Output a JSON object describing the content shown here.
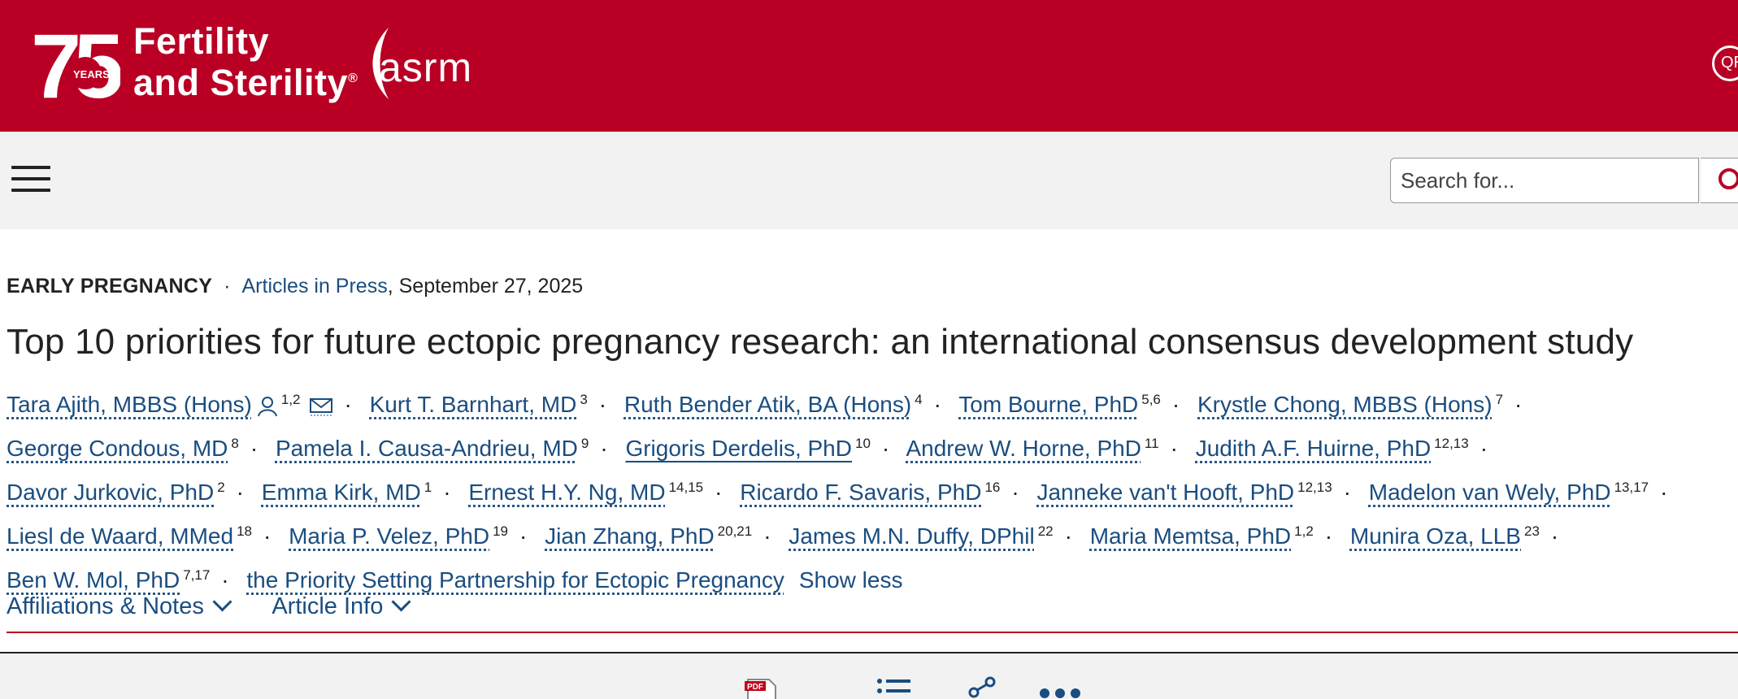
{
  "header": {
    "logo_number": "75",
    "logo_years": "YEARS",
    "journal_line1": "Fertility",
    "journal_line2": "and Sterility",
    "trademark": "®",
    "partner": "asrm",
    "qr_label": "QR",
    "brand_color": "#b90024"
  },
  "nav": {
    "menu_icon": "hamburger-menu-icon",
    "search_placeholder": "Search for...",
    "search_icon": "search-icon"
  },
  "article": {
    "section": "EARLY PREGNANCY",
    "status": "Articles in Press",
    "date": ", September 27, 2025",
    "title": "Top 10 priorities for future ectopic pregnancy research: an international consensus development study",
    "authors": [
      {
        "name": "Tara Ajith, MBBS (Hons)",
        "sup": "1,2"
      },
      {
        "name": "Kurt T. Barnhart, MD",
        "sup": "3"
      },
      {
        "name": "Ruth Bender Atik, BA (Hons)",
        "sup": "4"
      },
      {
        "name": "Tom Bourne, PhD",
        "sup": "5,6"
      },
      {
        "name": "Krystle Chong, MBBS (Hons)",
        "sup": "7"
      },
      {
        "name": "George Condous, MD",
        "sup": "8"
      },
      {
        "name": "Pamela I. Causa-Andrieu, MD",
        "sup": "9"
      },
      {
        "name": "Grigoris Derdelis, PhD",
        "sup": "10"
      },
      {
        "name": "Andrew W. Horne, PhD",
        "sup": "11"
      },
      {
        "name": "Judith A.F. Huirne, PhD",
        "sup": "12,13"
      },
      {
        "name": "Davor Jurkovic, PhD",
        "sup": "2"
      },
      {
        "name": "Emma Kirk, MD",
        "sup": "1"
      },
      {
        "name": "Ernest H.Y. Ng, MD",
        "sup": "14,15"
      },
      {
        "name": "Ricardo F. Savaris, PhD",
        "sup": "16"
      },
      {
        "name": "Janneke van't Hooft, PhD",
        "sup": "12,13"
      },
      {
        "name": "Madelon van Wely, PhD",
        "sup": "13,17"
      },
      {
        "name": "Liesl de Waard, MMed",
        "sup": "18"
      },
      {
        "name": "Maria P. Velez, PhD",
        "sup": "19"
      },
      {
        "name": "Jian Zhang, PhD",
        "sup": "20,21"
      },
      {
        "name": "James M.N. Duffy, DPhil",
        "sup": "22"
      },
      {
        "name": "Maria Memtsa, PhD",
        "sup": "1,2"
      },
      {
        "name": "Munira Oza, LLB",
        "sup": "23"
      },
      {
        "name": "Ben W. Mol, PhD",
        "sup": "7,17"
      },
      {
        "name": "the Priority Setting Partnership for Ectopic Pregnancy",
        "sup": ""
      }
    ],
    "show_less": "Show less",
    "tabs": [
      "Affiliations & Notes",
      "Article Info"
    ]
  },
  "toolbar": {
    "icons": [
      "pdf-icon",
      "outline-list-icon",
      "share-icon",
      "more-icon"
    ],
    "pdf_label": "PDF"
  }
}
